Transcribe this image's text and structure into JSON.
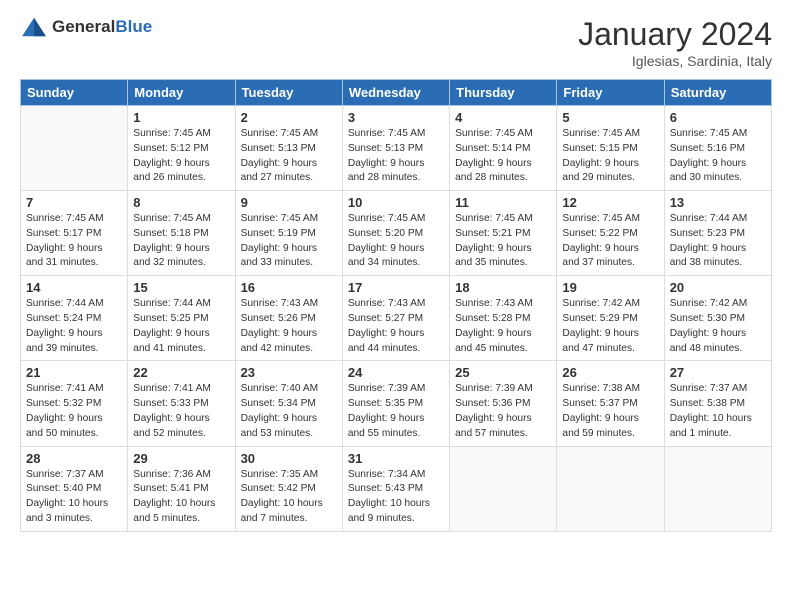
{
  "logo": {
    "general": "General",
    "blue": "Blue"
  },
  "title": "January 2024",
  "subtitle": "Iglesias, Sardinia, Italy",
  "weekdays": [
    "Sunday",
    "Monday",
    "Tuesday",
    "Wednesday",
    "Thursday",
    "Friday",
    "Saturday"
  ],
  "weeks": [
    [
      {
        "day": "",
        "info": ""
      },
      {
        "day": "1",
        "info": "Sunrise: 7:45 AM\nSunset: 5:12 PM\nDaylight: 9 hours\nand 26 minutes."
      },
      {
        "day": "2",
        "info": "Sunrise: 7:45 AM\nSunset: 5:13 PM\nDaylight: 9 hours\nand 27 minutes."
      },
      {
        "day": "3",
        "info": "Sunrise: 7:45 AM\nSunset: 5:13 PM\nDaylight: 9 hours\nand 28 minutes."
      },
      {
        "day": "4",
        "info": "Sunrise: 7:45 AM\nSunset: 5:14 PM\nDaylight: 9 hours\nand 28 minutes."
      },
      {
        "day": "5",
        "info": "Sunrise: 7:45 AM\nSunset: 5:15 PM\nDaylight: 9 hours\nand 29 minutes."
      },
      {
        "day": "6",
        "info": "Sunrise: 7:45 AM\nSunset: 5:16 PM\nDaylight: 9 hours\nand 30 minutes."
      }
    ],
    [
      {
        "day": "7",
        "info": "Sunrise: 7:45 AM\nSunset: 5:17 PM\nDaylight: 9 hours\nand 31 minutes."
      },
      {
        "day": "8",
        "info": "Sunrise: 7:45 AM\nSunset: 5:18 PM\nDaylight: 9 hours\nand 32 minutes."
      },
      {
        "day": "9",
        "info": "Sunrise: 7:45 AM\nSunset: 5:19 PM\nDaylight: 9 hours\nand 33 minutes."
      },
      {
        "day": "10",
        "info": "Sunrise: 7:45 AM\nSunset: 5:20 PM\nDaylight: 9 hours\nand 34 minutes."
      },
      {
        "day": "11",
        "info": "Sunrise: 7:45 AM\nSunset: 5:21 PM\nDaylight: 9 hours\nand 35 minutes."
      },
      {
        "day": "12",
        "info": "Sunrise: 7:45 AM\nSunset: 5:22 PM\nDaylight: 9 hours\nand 37 minutes."
      },
      {
        "day": "13",
        "info": "Sunrise: 7:44 AM\nSunset: 5:23 PM\nDaylight: 9 hours\nand 38 minutes."
      }
    ],
    [
      {
        "day": "14",
        "info": "Sunrise: 7:44 AM\nSunset: 5:24 PM\nDaylight: 9 hours\nand 39 minutes."
      },
      {
        "day": "15",
        "info": "Sunrise: 7:44 AM\nSunset: 5:25 PM\nDaylight: 9 hours\nand 41 minutes."
      },
      {
        "day": "16",
        "info": "Sunrise: 7:43 AM\nSunset: 5:26 PM\nDaylight: 9 hours\nand 42 minutes."
      },
      {
        "day": "17",
        "info": "Sunrise: 7:43 AM\nSunset: 5:27 PM\nDaylight: 9 hours\nand 44 minutes."
      },
      {
        "day": "18",
        "info": "Sunrise: 7:43 AM\nSunset: 5:28 PM\nDaylight: 9 hours\nand 45 minutes."
      },
      {
        "day": "19",
        "info": "Sunrise: 7:42 AM\nSunset: 5:29 PM\nDaylight: 9 hours\nand 47 minutes."
      },
      {
        "day": "20",
        "info": "Sunrise: 7:42 AM\nSunset: 5:30 PM\nDaylight: 9 hours\nand 48 minutes."
      }
    ],
    [
      {
        "day": "21",
        "info": "Sunrise: 7:41 AM\nSunset: 5:32 PM\nDaylight: 9 hours\nand 50 minutes."
      },
      {
        "day": "22",
        "info": "Sunrise: 7:41 AM\nSunset: 5:33 PM\nDaylight: 9 hours\nand 52 minutes."
      },
      {
        "day": "23",
        "info": "Sunrise: 7:40 AM\nSunset: 5:34 PM\nDaylight: 9 hours\nand 53 minutes."
      },
      {
        "day": "24",
        "info": "Sunrise: 7:39 AM\nSunset: 5:35 PM\nDaylight: 9 hours\nand 55 minutes."
      },
      {
        "day": "25",
        "info": "Sunrise: 7:39 AM\nSunset: 5:36 PM\nDaylight: 9 hours\nand 57 minutes."
      },
      {
        "day": "26",
        "info": "Sunrise: 7:38 AM\nSunset: 5:37 PM\nDaylight: 9 hours\nand 59 minutes."
      },
      {
        "day": "27",
        "info": "Sunrise: 7:37 AM\nSunset: 5:38 PM\nDaylight: 10 hours\nand 1 minute."
      }
    ],
    [
      {
        "day": "28",
        "info": "Sunrise: 7:37 AM\nSunset: 5:40 PM\nDaylight: 10 hours\nand 3 minutes."
      },
      {
        "day": "29",
        "info": "Sunrise: 7:36 AM\nSunset: 5:41 PM\nDaylight: 10 hours\nand 5 minutes."
      },
      {
        "day": "30",
        "info": "Sunrise: 7:35 AM\nSunset: 5:42 PM\nDaylight: 10 hours\nand 7 minutes."
      },
      {
        "day": "31",
        "info": "Sunrise: 7:34 AM\nSunset: 5:43 PM\nDaylight: 10 hours\nand 9 minutes."
      },
      {
        "day": "",
        "info": ""
      },
      {
        "day": "",
        "info": ""
      },
      {
        "day": "",
        "info": ""
      }
    ]
  ]
}
